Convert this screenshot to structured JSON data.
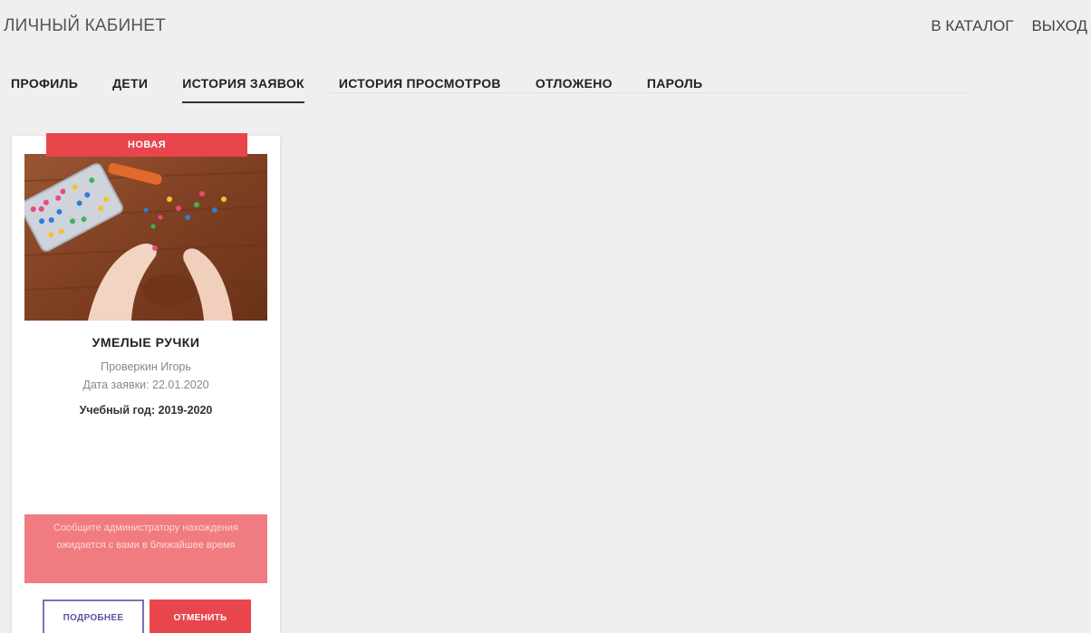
{
  "header": {
    "title": "ЛИЧНЫЙ КАБИНЕТ",
    "links": [
      "В КАТАЛОГ",
      "ВЫХОД"
    ]
  },
  "tabs": [
    {
      "label": "ПРОФИЛЬ",
      "active": false
    },
    {
      "label": "ДЕТИ",
      "active": false
    },
    {
      "label": "ИСТОРИЯ ЗАЯВОК",
      "active": true
    },
    {
      "label": "ИСТОРИЯ ПРОСМОТРОВ",
      "active": false
    },
    {
      "label": "ОТЛОЖЕНО",
      "active": false
    },
    {
      "label": "ПАРОЛЬ",
      "active": false
    }
  ],
  "card": {
    "status": "НОВАЯ",
    "photo_icon": "beads-craft-photo",
    "title": "УМЕЛЫЕ РУЧКИ",
    "child": "Проверкин Игорь",
    "date": "Дата заявки: 22.01.2020",
    "year": "Учебный год: 2019-2020",
    "notice": "Сообщите администратору нахождения ожидается с вами в ближайшее время",
    "details_label": "ПОДРОБНЕЕ",
    "cancel_label": "ОТМЕНИТЬ"
  },
  "colors": {
    "accent": "#e9454c",
    "notice": "#f0747a",
    "details_border": "#7c6fb5",
    "background": "#efefef"
  }
}
